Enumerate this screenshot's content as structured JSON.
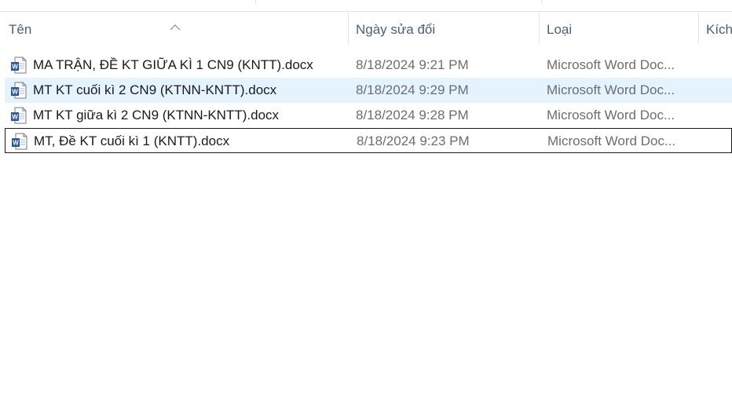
{
  "columns": {
    "name": "Tên",
    "date": "Ngày sửa đổi",
    "type": "Loại",
    "size": "Kích"
  },
  "files": [
    {
      "name": "MA TRẬN, ĐỀ KT GIỮA KÌ 1 CN9 (KNTT).docx",
      "date": "8/18/2024 9:21 PM",
      "type": "Microsoft Word Doc...",
      "icon": "word-document-icon",
      "selected": false,
      "focused": false
    },
    {
      "name": "MT KT cuối kì 2 CN9 (KTNN-KNTT).docx",
      "date": "8/18/2024 9:29 PM",
      "type": "Microsoft Word Doc...",
      "icon": "word-document-icon",
      "selected": true,
      "focused": false
    },
    {
      "name": "MT KT giữa kì 2 CN9 (KTNN-KNTT).docx",
      "date": "8/18/2024 9:28 PM",
      "type": "Microsoft Word Doc...",
      "icon": "word-document-icon",
      "selected": false,
      "focused": false
    },
    {
      "name": "MT, Đề KT cuối kì 1 (KNTT).docx",
      "date": "8/18/2024 9:23 PM",
      "type": "Microsoft Word Doc...",
      "icon": "word-document-icon",
      "selected": false,
      "focused": true
    }
  ],
  "colors": {
    "selection": "#e5f3ff",
    "header_text": "#4c607a",
    "secondary_text": "#6d6d6d",
    "word_blue": "#2b579a"
  }
}
